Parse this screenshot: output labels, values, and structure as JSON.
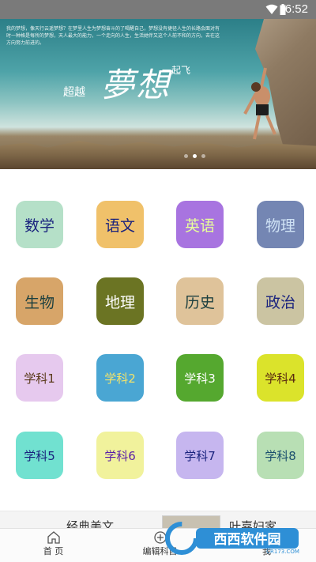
{
  "status_bar": {
    "time": "6:52"
  },
  "banner": {
    "small_text": "我的梦想，像天行云遥梦想？在梦里人生为梦想奋斗的了喝醒自己，梦想没有捷径人生的长路会面对有时一种格是每所的梦想，天人最大的能力，一个走向的人生，生活她伴又这个人前不和的方向，去在这方向努力前进的。",
    "title_pre": "超越",
    "title_main": "夢想",
    "title_post": "一起飞"
  },
  "subjects": [
    {
      "label": "数学",
      "bg": "#b5e0c8",
      "fg": "#1a237e"
    },
    {
      "label": "语文",
      "bg": "#f0c16a",
      "fg": "#1a237e"
    },
    {
      "label": "英语",
      "bg": "#a874e0",
      "fg": "#e8ff9a"
    },
    {
      "label": "物理",
      "bg": "#7486b3",
      "fg": "#cfe2f5"
    },
    {
      "label": "生物",
      "bg": "#d7a569",
      "fg": "#1b3f3f"
    },
    {
      "label": "地理",
      "bg": "#6b7423",
      "fg": "#ffffff"
    },
    {
      "label": "历史",
      "bg": "#dfc39a",
      "fg": "#1b3f3f"
    },
    {
      "label": "政治",
      "bg": "#cbc4a2",
      "fg": "#1a237e"
    },
    {
      "label": "学科1",
      "bg": "#e6c9ee",
      "fg": "#5a3a1a"
    },
    {
      "label": "学科2",
      "bg": "#4aa6d3",
      "fg": "#f3e36a"
    },
    {
      "label": "学科3",
      "bg": "#55a82f",
      "fg": "#ffffff"
    },
    {
      "label": "学科4",
      "bg": "#dbe32b",
      "fg": "#5a2a10"
    },
    {
      "label": "学科5",
      "bg": "#71e1d0",
      "fg": "#1a237e"
    },
    {
      "label": "学科6",
      "bg": "#f1f29c",
      "fg": "#5a1fa8"
    },
    {
      "label": "学科7",
      "bg": "#c6b6ef",
      "fg": "#1a237e"
    },
    {
      "label": "学科8",
      "bg": "#b8dfb4",
      "fg": "#1b4f6e"
    }
  ],
  "ad": {
    "left_text": "经典美文",
    "right_text": "叶嘉妇家"
  },
  "tabs": [
    {
      "label": "首 页",
      "icon": "home-icon"
    },
    {
      "label": "编辑科目",
      "icon": "edit-subjects-icon"
    },
    {
      "label": "我",
      "icon": "profile-icon"
    }
  ],
  "watermark": {
    "text": "西西软件园",
    "sub": "CR173.COM"
  }
}
